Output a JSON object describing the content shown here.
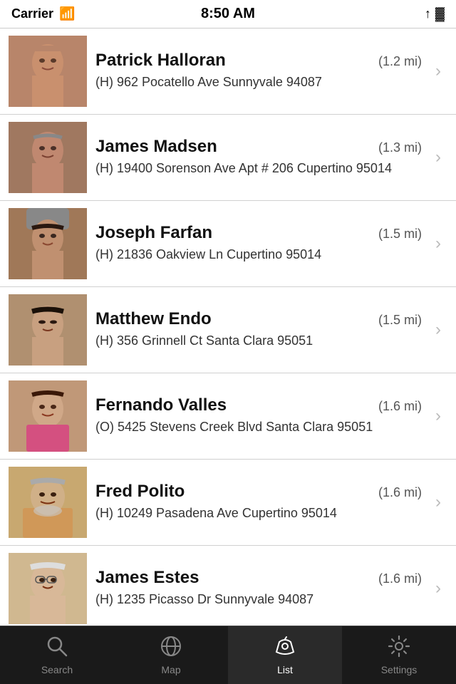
{
  "status_bar": {
    "carrier": "Carrier",
    "time": "8:50 AM"
  },
  "people": [
    {
      "id": 1,
      "name": "Patrick Halloran",
      "distance": "(1.2 mi)",
      "address_type": "H",
      "address": "962 Pocatello Ave Sunnyvale 94087",
      "photo_class": "photo-1"
    },
    {
      "id": 2,
      "name": "James Madsen",
      "distance": "(1.3 mi)",
      "address_type": "H",
      "address": "19400 Sorenson Ave Apt # 206 Cupertino 95014",
      "photo_class": "photo-2"
    },
    {
      "id": 3,
      "name": "Joseph Farfan",
      "distance": "(1.5 mi)",
      "address_type": "H",
      "address": "21836 Oakview Ln Cupertino 95014",
      "photo_class": "photo-3"
    },
    {
      "id": 4,
      "name": "Matthew Endo",
      "distance": "(1.5 mi)",
      "address_type": "H",
      "address": "356 Grinnell Ct Santa Clara 95051",
      "photo_class": "photo-4"
    },
    {
      "id": 5,
      "name": "Fernando Valles",
      "distance": "(1.6 mi)",
      "address_type": "O",
      "address": "5425 Stevens Creek Blvd Santa Clara 95051",
      "photo_class": "photo-5"
    },
    {
      "id": 6,
      "name": "Fred Polito",
      "distance": "(1.6 mi)",
      "address_type": "H",
      "address": "10249 Pasadena Ave Cupertino 95014",
      "photo_class": "photo-6"
    },
    {
      "id": 7,
      "name": "James Estes",
      "distance": "(1.6 mi)",
      "address_type": "H",
      "address": "1235 Picasso Dr Sunnyvale 94087",
      "photo_class": "photo-7"
    }
  ],
  "tabs": [
    {
      "id": "search",
      "label": "Search",
      "active": false
    },
    {
      "id": "map",
      "label": "Map",
      "active": false
    },
    {
      "id": "list",
      "label": "List",
      "active": true
    },
    {
      "id": "settings",
      "label": "Settings",
      "active": false
    }
  ],
  "chevron": "›"
}
